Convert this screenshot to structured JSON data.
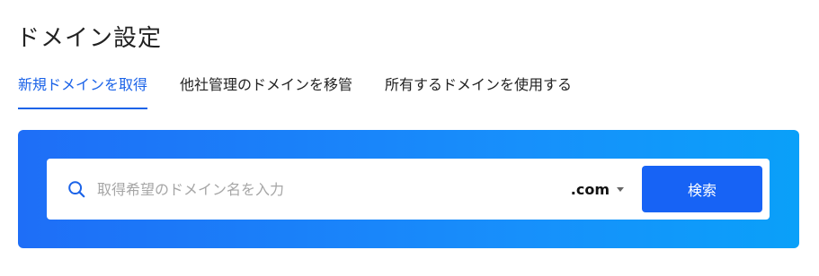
{
  "page": {
    "title": "ドメイン設定"
  },
  "tabs": [
    {
      "label": "新規ドメインを取得",
      "active": true
    },
    {
      "label": "他社管理のドメインを移管",
      "active": false
    },
    {
      "label": "所有するドメインを使用する",
      "active": false
    }
  ],
  "search": {
    "icon": "search-icon",
    "placeholder": "取得希望のドメイン名を入力",
    "value": "",
    "tld": ".com",
    "button_label": "検索"
  },
  "colors": {
    "accent": "#1b63e8",
    "button": "#1763f5",
    "gradient_start": "#1e6ef7",
    "gradient_end": "#0aa0f9"
  }
}
